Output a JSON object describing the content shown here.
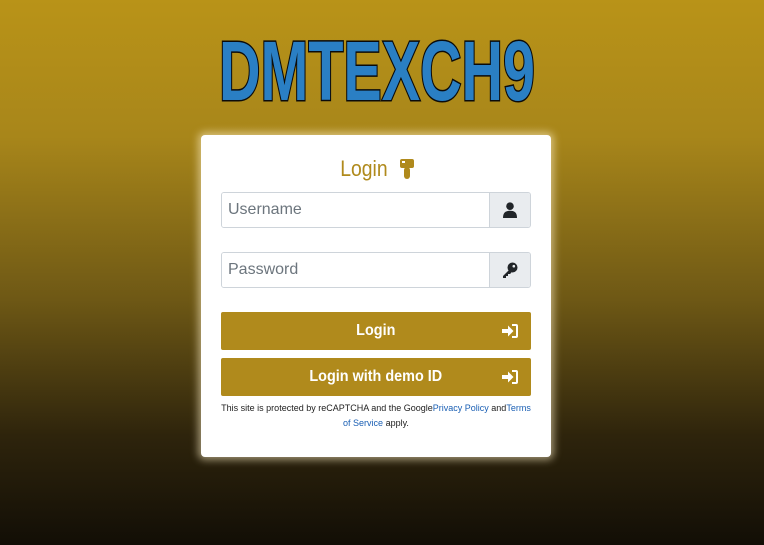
{
  "logo": {
    "text": "DMTEXCH9",
    "fill_color": "#2a7fc4",
    "outline_color": "#0b0b0b"
  },
  "login_card": {
    "title": "Login",
    "title_icon": "pointing-hand-icon",
    "accent_color": "#b08a1c",
    "username": {
      "placeholder": "Username",
      "value": "",
      "icon": "user-icon"
    },
    "password": {
      "placeholder": "Password",
      "value": "",
      "icon": "key-icon"
    },
    "login_button": {
      "label": "Login",
      "icon": "sign-in-icon"
    },
    "demo_button": {
      "label": "Login with demo ID",
      "icon": "sign-in-icon"
    },
    "recaptcha": {
      "text_before": "This site is protected by reCAPTCHA and the Google",
      "privacy_link": "Privacy Policy",
      "text_middle": " and",
      "terms_link": "Terms of Service",
      "text_after": " apply."
    }
  }
}
